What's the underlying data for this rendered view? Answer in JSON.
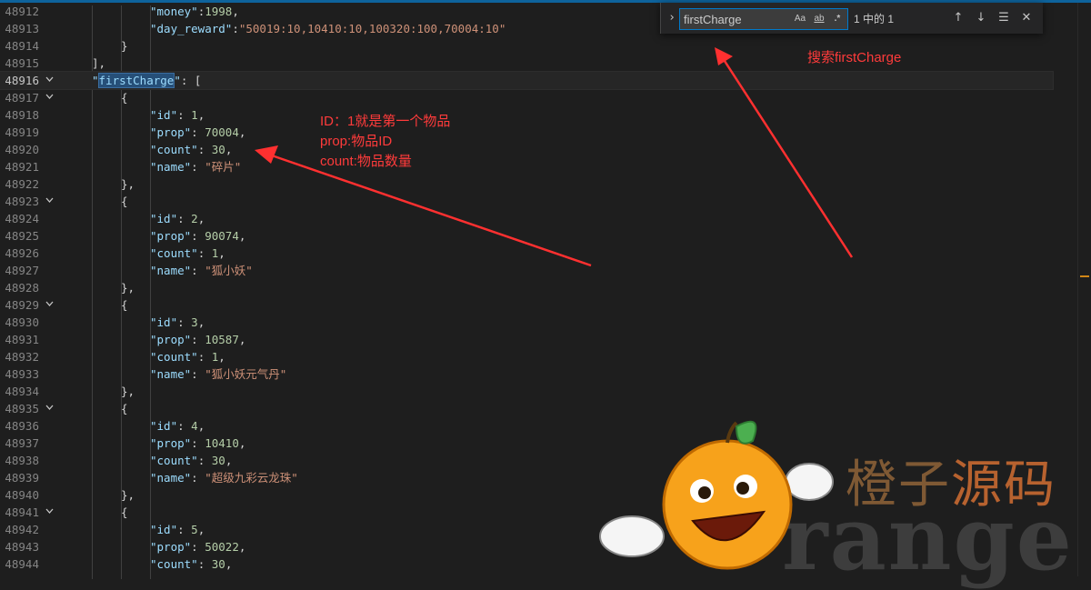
{
  "editor": {
    "lines": [
      {
        "num": "48912",
        "fold": false,
        "indent": 4,
        "tokens": [
          {
            "t": "k",
            "v": "\"money\""
          },
          {
            "t": "p",
            "v": ":"
          },
          {
            "t": "n",
            "v": "1998"
          },
          {
            "t": "p",
            "v": ","
          }
        ]
      },
      {
        "num": "48913",
        "fold": false,
        "indent": 4,
        "tokens": [
          {
            "t": "k",
            "v": "\"day_reward\""
          },
          {
            "t": "p",
            "v": ":"
          },
          {
            "t": "s",
            "v": "\"50019:10,10410:10,100320:100,70004:10\""
          }
        ]
      },
      {
        "num": "48914",
        "fold": false,
        "indent": 3,
        "tokens": [
          {
            "t": "p",
            "v": "}"
          }
        ]
      },
      {
        "num": "48915",
        "fold": false,
        "indent": 2,
        "tokens": [
          {
            "t": "p",
            "v": "],"
          }
        ]
      },
      {
        "num": "48916",
        "fold": true,
        "current": true,
        "indent": 2,
        "tokens": [
          {
            "t": "k",
            "v": "\""
          },
          {
            "t": "k",
            "v": "firstCharge",
            "hl": true
          },
          {
            "t": "k",
            "v": "\""
          },
          {
            "t": "p",
            "v": ": ["
          }
        ]
      },
      {
        "num": "48917",
        "fold": true,
        "indent": 3,
        "tokens": [
          {
            "t": "p",
            "v": "{"
          }
        ]
      },
      {
        "num": "48918",
        "fold": false,
        "indent": 4,
        "tokens": [
          {
            "t": "k",
            "v": "\"id\""
          },
          {
            "t": "p",
            "v": ": "
          },
          {
            "t": "n",
            "v": "1"
          },
          {
            "t": "p",
            "v": ","
          }
        ]
      },
      {
        "num": "48919",
        "fold": false,
        "indent": 4,
        "tokens": [
          {
            "t": "k",
            "v": "\"prop\""
          },
          {
            "t": "p",
            "v": ": "
          },
          {
            "t": "n",
            "v": "70004"
          },
          {
            "t": "p",
            "v": ","
          }
        ]
      },
      {
        "num": "48920",
        "fold": false,
        "indent": 4,
        "tokens": [
          {
            "t": "k",
            "v": "\"count\""
          },
          {
            "t": "p",
            "v": ": "
          },
          {
            "t": "n",
            "v": "30"
          },
          {
            "t": "p",
            "v": ","
          }
        ]
      },
      {
        "num": "48921",
        "fold": false,
        "indent": 4,
        "tokens": [
          {
            "t": "k",
            "v": "\"name\""
          },
          {
            "t": "p",
            "v": ": "
          },
          {
            "t": "s",
            "v": "\"碎片\""
          }
        ]
      },
      {
        "num": "48922",
        "fold": false,
        "indent": 3,
        "tokens": [
          {
            "t": "p",
            "v": "},"
          }
        ]
      },
      {
        "num": "48923",
        "fold": true,
        "indent": 3,
        "tokens": [
          {
            "t": "p",
            "v": "{"
          }
        ]
      },
      {
        "num": "48924",
        "fold": false,
        "indent": 4,
        "tokens": [
          {
            "t": "k",
            "v": "\"id\""
          },
          {
            "t": "p",
            "v": ": "
          },
          {
            "t": "n",
            "v": "2"
          },
          {
            "t": "p",
            "v": ","
          }
        ]
      },
      {
        "num": "48925",
        "fold": false,
        "indent": 4,
        "tokens": [
          {
            "t": "k",
            "v": "\"prop\""
          },
          {
            "t": "p",
            "v": ": "
          },
          {
            "t": "n",
            "v": "90074"
          },
          {
            "t": "p",
            "v": ","
          }
        ]
      },
      {
        "num": "48926",
        "fold": false,
        "indent": 4,
        "tokens": [
          {
            "t": "k",
            "v": "\"count\""
          },
          {
            "t": "p",
            "v": ": "
          },
          {
            "t": "n",
            "v": "1"
          },
          {
            "t": "p",
            "v": ","
          }
        ]
      },
      {
        "num": "48927",
        "fold": false,
        "indent": 4,
        "tokens": [
          {
            "t": "k",
            "v": "\"name\""
          },
          {
            "t": "p",
            "v": ": "
          },
          {
            "t": "s",
            "v": "\"狐小妖\""
          }
        ]
      },
      {
        "num": "48928",
        "fold": false,
        "indent": 3,
        "tokens": [
          {
            "t": "p",
            "v": "},"
          }
        ]
      },
      {
        "num": "48929",
        "fold": true,
        "indent": 3,
        "tokens": [
          {
            "t": "p",
            "v": "{"
          }
        ]
      },
      {
        "num": "48930",
        "fold": false,
        "indent": 4,
        "tokens": [
          {
            "t": "k",
            "v": "\"id\""
          },
          {
            "t": "p",
            "v": ": "
          },
          {
            "t": "n",
            "v": "3"
          },
          {
            "t": "p",
            "v": ","
          }
        ]
      },
      {
        "num": "48931",
        "fold": false,
        "indent": 4,
        "tokens": [
          {
            "t": "k",
            "v": "\"prop\""
          },
          {
            "t": "p",
            "v": ": "
          },
          {
            "t": "n",
            "v": "10587"
          },
          {
            "t": "p",
            "v": ","
          }
        ]
      },
      {
        "num": "48932",
        "fold": false,
        "indent": 4,
        "tokens": [
          {
            "t": "k",
            "v": "\"count\""
          },
          {
            "t": "p",
            "v": ": "
          },
          {
            "t": "n",
            "v": "1"
          },
          {
            "t": "p",
            "v": ","
          }
        ]
      },
      {
        "num": "48933",
        "fold": false,
        "indent": 4,
        "tokens": [
          {
            "t": "k",
            "v": "\"name\""
          },
          {
            "t": "p",
            "v": ": "
          },
          {
            "t": "s",
            "v": "\"狐小妖元气丹\""
          }
        ]
      },
      {
        "num": "48934",
        "fold": false,
        "indent": 3,
        "tokens": [
          {
            "t": "p",
            "v": "},"
          }
        ]
      },
      {
        "num": "48935",
        "fold": true,
        "indent": 3,
        "tokens": [
          {
            "t": "p",
            "v": "{"
          }
        ]
      },
      {
        "num": "48936",
        "fold": false,
        "indent": 4,
        "tokens": [
          {
            "t": "k",
            "v": "\"id\""
          },
          {
            "t": "p",
            "v": ": "
          },
          {
            "t": "n",
            "v": "4"
          },
          {
            "t": "p",
            "v": ","
          }
        ]
      },
      {
        "num": "48937",
        "fold": false,
        "indent": 4,
        "tokens": [
          {
            "t": "k",
            "v": "\"prop\""
          },
          {
            "t": "p",
            "v": ": "
          },
          {
            "t": "n",
            "v": "10410"
          },
          {
            "t": "p",
            "v": ","
          }
        ]
      },
      {
        "num": "48938",
        "fold": false,
        "indent": 4,
        "tokens": [
          {
            "t": "k",
            "v": "\"count\""
          },
          {
            "t": "p",
            "v": ": "
          },
          {
            "t": "n",
            "v": "30"
          },
          {
            "t": "p",
            "v": ","
          }
        ]
      },
      {
        "num": "48939",
        "fold": false,
        "indent": 4,
        "tokens": [
          {
            "t": "k",
            "v": "\"name\""
          },
          {
            "t": "p",
            "v": ": "
          },
          {
            "t": "s",
            "v": "\"超级九彩云龙珠\""
          }
        ]
      },
      {
        "num": "48940",
        "fold": false,
        "indent": 3,
        "tokens": [
          {
            "t": "p",
            "v": "},"
          }
        ]
      },
      {
        "num": "48941",
        "fold": true,
        "indent": 3,
        "tokens": [
          {
            "t": "p",
            "v": "{"
          }
        ]
      },
      {
        "num": "48942",
        "fold": false,
        "indent": 4,
        "tokens": [
          {
            "t": "k",
            "v": "\"id\""
          },
          {
            "t": "p",
            "v": ": "
          },
          {
            "t": "n",
            "v": "5"
          },
          {
            "t": "p",
            "v": ","
          }
        ]
      },
      {
        "num": "48943",
        "fold": false,
        "indent": 4,
        "tokens": [
          {
            "t": "k",
            "v": "\"prop\""
          },
          {
            "t": "p",
            "v": ": "
          },
          {
            "t": "n",
            "v": "50022"
          },
          {
            "t": "p",
            "v": ","
          }
        ]
      },
      {
        "num": "48944",
        "fold": false,
        "indent": 4,
        "tokens": [
          {
            "t": "k",
            "v": "\"count\""
          },
          {
            "t": "p",
            "v": ": "
          },
          {
            "t": "n",
            "v": "30"
          },
          {
            "t": "p",
            "v": ","
          }
        ]
      }
    ]
  },
  "find_widget": {
    "toggle_icon": "chevron-right-icon",
    "search_value": "firstCharge",
    "match_case_label": "Aa",
    "whole_word_label": "ab",
    "regex_label": ".*",
    "result_count": "1 中的 1",
    "prev_icon": "arrow-up-icon",
    "next_icon": "arrow-down-icon",
    "selection_icon": "find-in-selection-icon",
    "close_icon": "close-icon"
  },
  "annotations": {
    "search_hint": "搜索firstCharge",
    "field_notes": [
      "ID：1就是第一个物品",
      "prop:物品ID",
      "count:物品数量"
    ],
    "color": "#ff3b3b"
  },
  "watermark": {
    "chinese_part1": "橙子",
    "chinese_part2": "源码",
    "english": "range"
  },
  "colors": {
    "background": "#1e1e1e",
    "key": "#9cdcfe",
    "string": "#ce9178",
    "number": "#b5cea8",
    "punctuation": "#d4d4d4",
    "accent": "#007acc"
  }
}
